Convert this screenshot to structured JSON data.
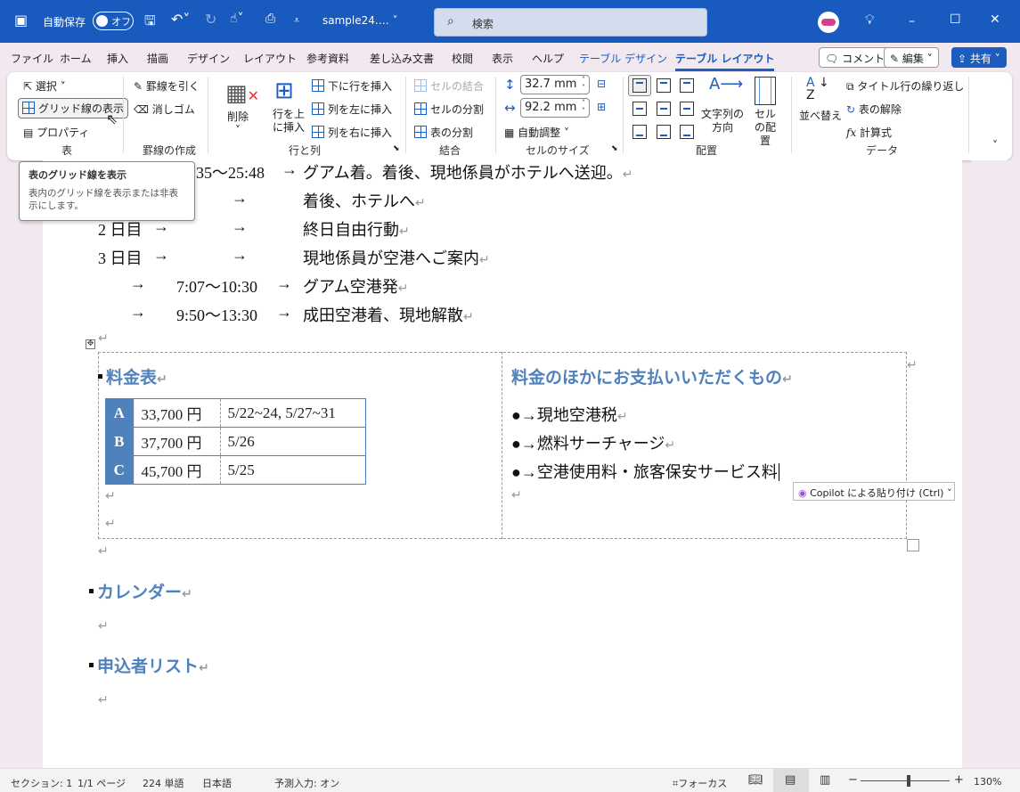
{
  "titlebar": {
    "autosave_label": "自動保存",
    "autosave_state": "オフ",
    "filename": "sample24.…",
    "search_placeholder": "検索",
    "colors": {
      "bar": "#185abd"
    }
  },
  "tabs": [
    "ファイル",
    "ホーム",
    "挿入",
    "描画",
    "デザイン",
    "レイアウト",
    "参考資料",
    "差し込み文書",
    "校閲",
    "表示",
    "ヘルプ",
    "テーブル デザイン",
    "テーブル レイアウト"
  ],
  "tab_buttons": {
    "comment": "コメント",
    "edit": "編集",
    "share": "共有"
  },
  "ribbon": {
    "table": {
      "select": "選択",
      "gridlines": "グリッド線の表示",
      "properties": "プロパティ",
      "group": "表"
    },
    "draw": {
      "draw_border": "罫線を引く",
      "eraser": "消しゴム",
      "group": "罫線の作成"
    },
    "rowscols": {
      "delete": "削除",
      "insert_above": "行を上に挿入",
      "insert_below": "下に行を挿入",
      "insert_left": "列を左に挿入",
      "insert_right": "列を右に挿入",
      "group": "行と列"
    },
    "merge": {
      "merge_cells": "セルの結合",
      "split_cells": "セルの分割",
      "split_table": "表の分割",
      "group": "結合"
    },
    "cellsize": {
      "height": "32.7 mm",
      "width": "92.2 mm",
      "autofit": "自動調整",
      "group": "セルのサイズ"
    },
    "alignment": {
      "text_direction": "文字列の方向",
      "cell_margins": "セルの配置",
      "group": "配置"
    },
    "data": {
      "sort": "並べ替え",
      "repeat_header": "タイトル行の繰り返し",
      "convert": "表の解除",
      "formula": "計算式",
      "group": "データ"
    }
  },
  "tooltip": {
    "title": "表のグリッド線を表示",
    "body": "表内のグリッド線を表示または非表示にします。"
  },
  "document": {
    "lines": [
      {
        "a": "",
        "b": "35～25:48",
        "c": "グアム着。着後、現地係員がホテルへ送迎。"
      },
      {
        "a": "",
        "b": "",
        "c": "着後、ホテルへ"
      },
      {
        "a": "2 日目",
        "b": "",
        "c": "終日自由行動"
      },
      {
        "a": "3 日目",
        "b": "",
        "c": "現地係員が空港へご案内"
      },
      {
        "a": "",
        "b": "7:07～10:30",
        "c": "グアム空港発"
      },
      {
        "a": "",
        "b": "9:50～13:30",
        "c": "成田空港着、現地解散"
      }
    ],
    "arrow": "→",
    "pilcrow": "↵",
    "fee_heading": "料金表",
    "fees": [
      {
        "key": "A",
        "price": "33,700 円",
        "dates": "5/22~24, 5/27~31"
      },
      {
        "key": "B",
        "price": "37,700 円",
        "dates": "5/26"
      },
      {
        "key": "C",
        "price": "45,700 円",
        "dates": "5/25"
      }
    ],
    "extra_heading": "料金のほかにお支払いいただくもの",
    "extras": [
      "現地空港税",
      "燃料サーチャージ",
      "空港使用料・旅客保安サービス料"
    ],
    "calendar_heading": "カレンダー",
    "applicants_heading": "申込者リスト",
    "heading_color": "#4f81bd"
  },
  "copilot_paste": "Copilot による貼り付け (Ctrl)",
  "status": {
    "section": "セクション: 1",
    "page": "1/1 ページ",
    "words": "224 単語",
    "language": "日本語",
    "predict": "予測入力: オン",
    "focus": "フォーカス",
    "zoom": "130%",
    "zoom_level": 130
  }
}
